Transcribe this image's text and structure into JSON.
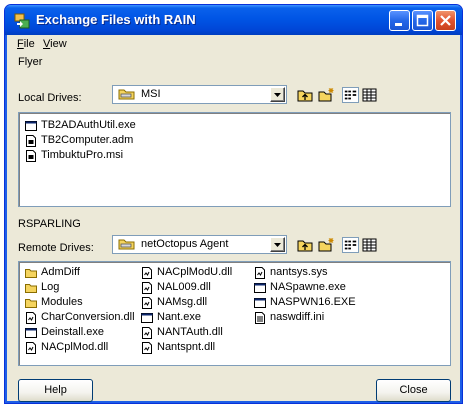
{
  "window": {
    "title": "Exchange Files with RAIN"
  },
  "menu": [
    {
      "label": "File",
      "key": "F",
      "rest": "ile"
    },
    {
      "label": "View",
      "key": "V",
      "rest": "iew"
    }
  ],
  "local": {
    "section": "Flyer",
    "drives_label": "Local Drives:",
    "drive": "MSI",
    "files": [
      {
        "name": "TB2ADAuthUtil.exe",
        "icon": "exe-icon"
      },
      {
        "name": "TB2Computer.adm",
        "icon": "document-icon"
      },
      {
        "name": "TimbuktuPro.msi",
        "icon": "document-icon"
      }
    ]
  },
  "remote": {
    "section": "RSPARLING",
    "drives_label": "Remote Drives:",
    "drive": "netOctopus Agent",
    "columns": [
      [
        {
          "name": "AdmDiff",
          "icon": "folder-icon"
        },
        {
          "name": "Log",
          "icon": "folder-icon"
        },
        {
          "name": "Modules",
          "icon": "folder-icon"
        },
        {
          "name": "CharConversion.dll",
          "icon": "dll-icon"
        },
        {
          "name": "Deinstall.exe",
          "icon": "exe-icon"
        },
        {
          "name": "NACplMod.dll",
          "icon": "dll-icon"
        }
      ],
      [
        {
          "name": "NACplModU.dll",
          "icon": "dll-icon"
        },
        {
          "name": "NAL009.dll",
          "icon": "dll-icon"
        },
        {
          "name": "NAMsg.dll",
          "icon": "dll-icon"
        },
        {
          "name": "Nant.exe",
          "icon": "exe-icon"
        },
        {
          "name": "NANTAuth.dll",
          "icon": "dll-icon"
        },
        {
          "name": "Nantspnt.dll",
          "icon": "dll-icon"
        }
      ],
      [
        {
          "name": "nantsys.sys",
          "icon": "dll-icon"
        },
        {
          "name": "NASpawne.exe",
          "icon": "exe-icon"
        },
        {
          "name": "NASPWN16.EXE",
          "icon": "exe-icon"
        },
        {
          "name": "naswdiff.ini",
          "icon": "ini-icon"
        }
      ]
    ]
  },
  "buttons": {
    "help": "Help",
    "close": "Close"
  },
  "colors": {
    "titlebar": "#0055e5",
    "face": "#ece9d8",
    "folder": "#f5d45e"
  }
}
